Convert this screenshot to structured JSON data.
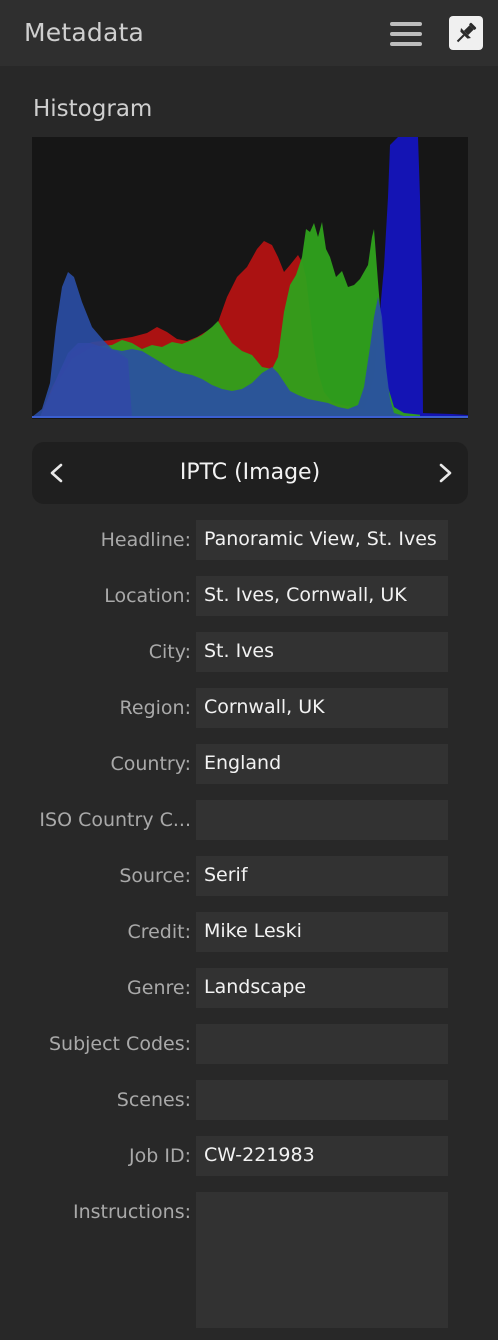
{
  "header": {
    "title": "Metadata"
  },
  "histogram": {
    "title": "Histogram"
  },
  "nav": {
    "title": "IPTC (Image)",
    "prev_label": "<",
    "next_label": ">"
  },
  "fields": [
    {
      "label": "Headline:",
      "value": "Panoramic View, St. Ives"
    },
    {
      "label": "Location:",
      "value": "St. Ives, Cornwall, UK"
    },
    {
      "label": "City:",
      "value": "St. Ives"
    },
    {
      "label": "Region:",
      "value": "Cornwall, UK"
    },
    {
      "label": "Country:",
      "value": "England"
    },
    {
      "label": "ISO Country C...",
      "value": ""
    },
    {
      "label": "Source:",
      "value": "Serif"
    },
    {
      "label": "Credit:",
      "value": "Mike Leski"
    },
    {
      "label": "Genre:",
      "value": "Landscape"
    },
    {
      "label": "Subject Codes:",
      "value": ""
    },
    {
      "label": "Scenes:",
      "value": ""
    },
    {
      "label": "Job ID:",
      "value": "CW-221983"
    },
    {
      "label": "Instructions:",
      "value": ""
    }
  ],
  "icons": {
    "menu": "hamburger-menu-icon",
    "pin": "pin-icon",
    "prev": "chevron-left-icon",
    "next": "chevron-right-icon"
  },
  "colors": {
    "background": "#282828",
    "header": "#2f2f2f",
    "field_bg": "#323232",
    "histogram_red": "#b01010",
    "histogram_green": "#2ea21a",
    "histogram_blue": "#1010b0"
  }
}
